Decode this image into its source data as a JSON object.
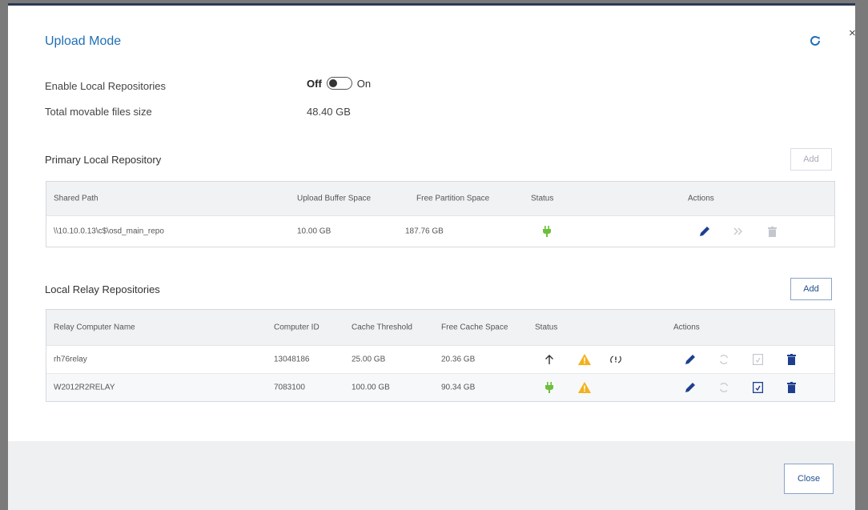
{
  "dialog": {
    "title": "Upload Mode",
    "close_label": "Close",
    "close_x": "×"
  },
  "settings": {
    "enable_local_repos_label": "Enable Local Repositories",
    "toggle_off_label": "Off",
    "toggle_on_label": "On",
    "toggle_state": "off",
    "total_size_label": "Total movable files size",
    "total_size_value": "48.40 GB"
  },
  "primary": {
    "title": "Primary Local Repository",
    "add_label": "Add",
    "headers": {
      "shared_path": "Shared Path",
      "upload_buffer": "Upload Buffer Space",
      "free_partition": "Free Partition Space",
      "status": "Status",
      "actions": "Actions"
    },
    "rows": [
      {
        "shared_path": "\\\\10.10.0.13\\c$\\osd_main_repo",
        "upload_buffer": "10.00 GB",
        "free_partition": "187.76 GB",
        "status_icons": [
          "plug-icon"
        ],
        "actions": [
          "edit-icon",
          "move-icon",
          "trash-icon"
        ]
      }
    ]
  },
  "relay": {
    "title": "Local Relay Repositories",
    "add_label": "Add",
    "headers": {
      "name": "Relay Computer Name",
      "computer_id": "Computer ID",
      "cache_threshold": "Cache Threshold",
      "free_cache": "Free Cache Space",
      "status": "Status",
      "actions": "Actions"
    },
    "rows": [
      {
        "name": "rh76relay",
        "computer_id": "13048186",
        "cache_threshold": "25.00 GB",
        "free_cache": "20.36 GB",
        "status_icons": [
          "arrow-up-icon",
          "warning-icon",
          "sync-pending-icon"
        ],
        "actions": [
          "edit-icon",
          "sync-icon",
          "document-icon",
          "trash-icon"
        ]
      },
      {
        "name": "W2012R2RELAY",
        "computer_id": "7083100",
        "cache_threshold": "100.00 GB",
        "free_cache": "90.34 GB",
        "status_icons": [
          "plug-icon",
          "warning-icon"
        ],
        "actions": [
          "edit-icon",
          "sync-icon",
          "document-icon",
          "trash-icon"
        ]
      }
    ]
  },
  "colors": {
    "accent_blue": "#1f6fb5",
    "action_blue": "#1e3f8f",
    "plug_green": "#6cbf3b",
    "warning_yellow": "#f2b21b",
    "disabled_gray": "#c4c7cc"
  }
}
